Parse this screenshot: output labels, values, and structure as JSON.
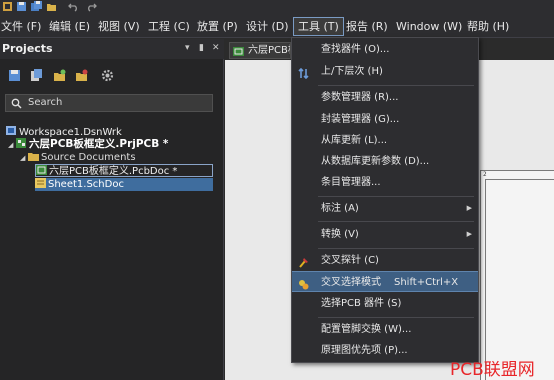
{
  "quickbar": {
    "icons": [
      "app-icon",
      "save-icon",
      "save-all-icon",
      "open-folder-icon",
      "undo-icon",
      "redo-icon"
    ]
  },
  "menubar": {
    "items": [
      "文件 (F)",
      "编辑 (E)",
      "视图 (V)",
      "工程 (C)",
      "放置 (P)",
      "设计 (D)",
      "工具 (T)",
      "报告 (R)",
      "Window (W)",
      "帮助 (H)"
    ],
    "active": "工具 (T)"
  },
  "projects": {
    "title": "Projects",
    "pin_glyphs": [
      "▾",
      "▮",
      "✕"
    ],
    "search_placeholder": "Search",
    "tree": {
      "workspace": "Workspace1.DsnWrk",
      "project": "六层PCB板框定义.PrjPCB *",
      "folder": "Source Documents",
      "pcb_doc": "六层PCB板框定义.PcbDoc *",
      "sch_doc": "Sheet1.SchDoc"
    }
  },
  "document": {
    "tab_label": "六层PCB板",
    "sheet_number": "2"
  },
  "tools_menu": {
    "items": [
      {
        "label": "查找器件 (O)...",
        "shortcut": ""
      },
      {
        "label": "上/下层次 (H)",
        "shortcut": ""
      },
      {
        "label": "参数管理器 (R)...",
        "shortcut": ""
      },
      {
        "label": "封装管理器 (G)...",
        "shortcut": ""
      },
      {
        "label": "从库更新 (L)...",
        "shortcut": ""
      },
      {
        "label": "从数据库更新参数 (D)...",
        "shortcut": ""
      },
      {
        "label": "条目管理器...",
        "shortcut": ""
      },
      {
        "label": "标注 (A)",
        "shortcut": ""
      },
      {
        "label": "转换 (V)",
        "shortcut": ""
      },
      {
        "label": "交叉探针 (C)",
        "shortcut": ""
      },
      {
        "label": "交叉选择模式",
        "shortcut": "Shift+Ctrl+X"
      },
      {
        "label": "选择PCB 器件 (S)",
        "shortcut": ""
      },
      {
        "label": "配置管脚交换 (W)...",
        "shortcut": ""
      },
      {
        "label": "原理图优先项 (P)...",
        "shortcut": ""
      }
    ],
    "highlighted": "交叉选择模式"
  },
  "watermark": "PCB联盟网",
  "colors": {
    "menu_bg": "#2d2d30",
    "highlight": "#3e5f83",
    "selection": "#3f6d9e",
    "watermark": "#e8262a"
  }
}
